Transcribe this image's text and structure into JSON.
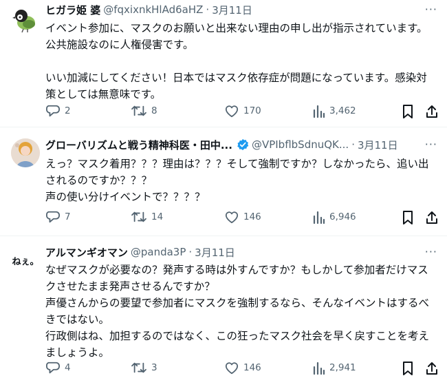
{
  "tweets": [
    {
      "name": "ヒガラ姫 婆",
      "handle": "@fqxixnkHlAd6aHZ",
      "date": "3月11日",
      "more": "···",
      "text": "イベント参加に、マスクのお願いと出来ない理由の申し出が指示されています。\n公共施設なのに人権侵害です。\n\nいい加減にしてください！日本ではマスク依存症が問題になっています。感染対\n策としては無意味です。",
      "replies": "2",
      "retweets": "8",
      "likes": "170",
      "views": "3,462"
    },
    {
      "name": "グローバリズムと戦う精神科医・田中...",
      "handle": "@VPIbflbSdnuQK...",
      "date": "3月11日",
      "more": "···",
      "text": "えっ？マスク着用？？？理由は？？？そして強制ですか？しなかったら、追い出\nされるのですか？？？\n声の使い分けイベントで？？？？",
      "replies": "7",
      "retweets": "14",
      "likes": "146",
      "views": "6,946"
    },
    {
      "name": "アルマンギオマン",
      "handle": "@panda3P",
      "date": "3月11日",
      "more": "···",
      "avatar_text": "ねぇ。",
      "text": "なぜマスクが必要なの？発声する時は外すんですか？もしかして参加者だけマス\nクさせたまま発声させるんですか？\n声優さんからの要望で参加者にマスクを強制するなら、そんなイベントはするべ\nきではない。\n行政側はね、加担するのではなく、この狂ったマスク社会を早く戻すことを考え\nましょうよ。",
      "replies": "4",
      "retweets": "3",
      "likes": "146",
      "views": "2,941"
    }
  ],
  "icons": {
    "reply": "speech-bubble-icon",
    "retweet": "repost-arrows-icon",
    "like": "heart-icon",
    "views": "bar-chart-icon",
    "bookmark": "bookmark-icon",
    "share": "share-upload-icon",
    "verified": "verified-badge-icon"
  },
  "colors": {
    "verified": "#1d9bf0",
    "secondary_text": "#536471",
    "divider": "#eff3f4"
  }
}
